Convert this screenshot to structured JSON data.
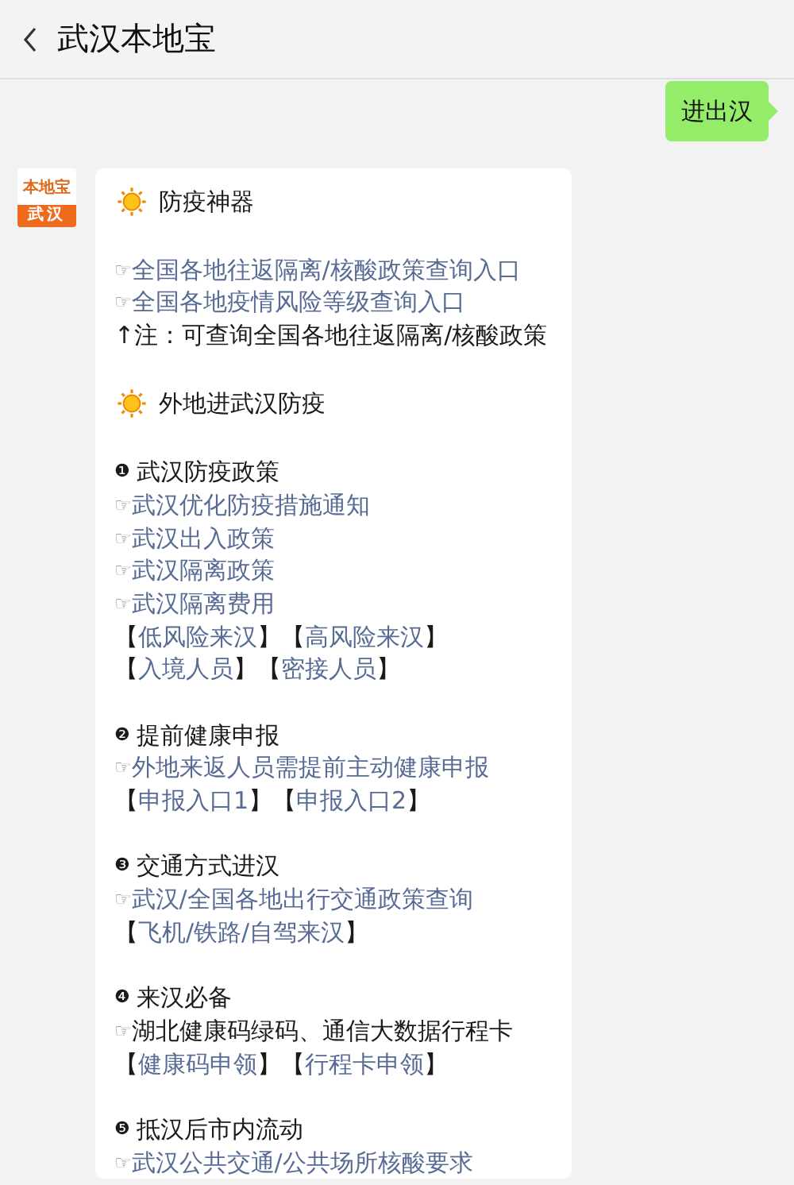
{
  "header": {
    "title": "武汉本地宝"
  },
  "sent_message": {
    "text": "进出汉"
  },
  "received_message": {
    "avatar": {
      "brand": "本地宝",
      "city": "武汉"
    },
    "lines": [
      {
        "kind": "heading",
        "text": "防疫神器"
      },
      {
        "kind": "blank"
      },
      {
        "kind": "link",
        "mark": "☞",
        "text": "全国各地往返隔离/核酸政策查询入口"
      },
      {
        "kind": "link",
        "mark": "☞",
        "text": "全国各地疫情风险等级查询入口"
      },
      {
        "kind": "note",
        "mark": "↑",
        "text": "注：可查询全国各地往返隔离/核酸政策"
      },
      {
        "kind": "blank"
      },
      {
        "kind": "heading",
        "text": "外地进武汉防疫"
      },
      {
        "kind": "blank"
      },
      {
        "kind": "section",
        "mark": "❶",
        "text": "武汉防疫政策"
      },
      {
        "kind": "link",
        "mark": "☞",
        "text": "武汉优化防疫措施通知"
      },
      {
        "kind": "link",
        "mark": "☞",
        "text": "武汉出入政策"
      },
      {
        "kind": "link",
        "mark": "☞",
        "text": "武汉隔离政策"
      },
      {
        "kind": "link",
        "mark": "☞",
        "text": "武汉隔离费用"
      },
      {
        "kind": "brackets",
        "open": "【",
        "close": "】",
        "links": [
          "低风险来汉",
          "高风险来汉"
        ]
      },
      {
        "kind": "brackets",
        "open": "【",
        "close": "】",
        "links": [
          "入境人员",
          "密接人员"
        ]
      },
      {
        "kind": "blank"
      },
      {
        "kind": "section",
        "mark": "❷",
        "text": "提前健康申报"
      },
      {
        "kind": "link",
        "mark": "☞",
        "text": "外地来返人员需提前主动健康申报"
      },
      {
        "kind": "brackets",
        "open": "【",
        "close": "】",
        "links": [
          "申报入口1",
          "申报入口2"
        ]
      },
      {
        "kind": "blank"
      },
      {
        "kind": "section",
        "mark": "❸",
        "text": "交通方式进汉"
      },
      {
        "kind": "link",
        "mark": "☞",
        "text": "武汉/全国各地出行交通政策查询"
      },
      {
        "kind": "brackets",
        "open": "【",
        "close": "】",
        "links": [
          "飞机/铁路/自驾来汉"
        ]
      },
      {
        "kind": "blank"
      },
      {
        "kind": "section",
        "mark": "❹",
        "text": "来汉必备"
      },
      {
        "kind": "plain",
        "mark": "☞",
        "text": "湖北健康码绿码、通信大数据行程卡"
      },
      {
        "kind": "brackets",
        "open": "【",
        "close": "】",
        "links": [
          "健康码申领",
          "行程卡申领"
        ]
      },
      {
        "kind": "blank"
      },
      {
        "kind": "section",
        "mark": "❺",
        "text": "抵汉后市内流动"
      },
      {
        "kind": "link",
        "mark": "☞",
        "text": "武汉公共交通/公共场所核酸要求"
      }
    ]
  }
}
